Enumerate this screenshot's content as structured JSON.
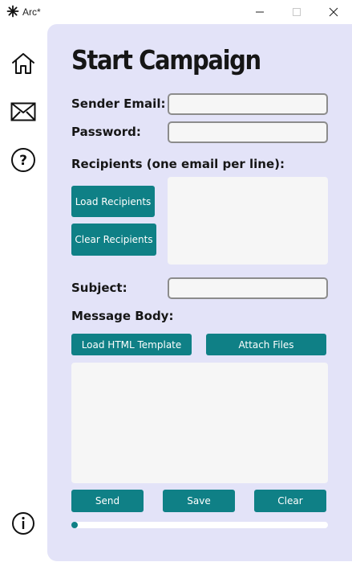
{
  "window": {
    "title": "Arc*",
    "icon": "asterisk-icon",
    "controls": [
      "minimize-icon",
      "maximize-icon",
      "close-icon"
    ]
  },
  "sidebar": {
    "items": [
      {
        "icon": "home-icon"
      },
      {
        "icon": "mail-icon"
      },
      {
        "icon": "help-icon"
      },
      {
        "icon": "info-icon"
      }
    ]
  },
  "main": {
    "title": "Start Campaign",
    "sender_email": {
      "label": "Sender Email:",
      "value": ""
    },
    "password": {
      "label": "Password:",
      "value": ""
    },
    "recipients": {
      "label": "Recipients (one email per line):",
      "value": "",
      "load_button": "Load Recipients",
      "clear_button": "Clear Recipients"
    },
    "subject": {
      "label": "Subject:",
      "value": ""
    },
    "message_body": {
      "label": "Message Body:",
      "value": "",
      "load_template_button": "Load HTML Template",
      "attach_button": "Attach Files"
    },
    "actions": {
      "send": "Send",
      "save": "Save",
      "clear": "Clear"
    },
    "progress": {
      "fraction": 0
    }
  },
  "colors": {
    "accent": "#0f8086",
    "panel": "#e3e3f8",
    "field": "#f6f6f6"
  }
}
